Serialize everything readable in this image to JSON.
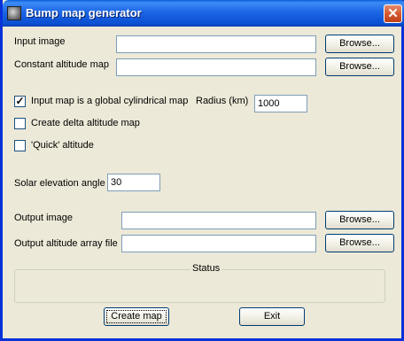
{
  "window": {
    "title": "Bump map generator",
    "close_glyph": "✕"
  },
  "inputs": {
    "input_image": {
      "label": "Input image",
      "value": "",
      "browse_label": "Browse..."
    },
    "constant_altitude_map": {
      "label": "Constant altitude map",
      "value": "",
      "browse_label": "Browse..."
    }
  },
  "options": {
    "global_cylindrical": {
      "label": "Input map is a global cylindrical map",
      "checked": true,
      "check_glyph": "✓"
    },
    "radius": {
      "label": "Radius (km)",
      "value": "1000"
    },
    "delta_altitude": {
      "label": "Create delta altitude map",
      "checked": false
    },
    "quick_altitude": {
      "label": "'Quick' altitude",
      "checked": false
    }
  },
  "solar": {
    "label": "Solar elevation angle",
    "value": "30"
  },
  "outputs": {
    "output_image": {
      "label": "Output image",
      "value": "",
      "browse_label": "Browse..."
    },
    "output_altitude_array": {
      "label": "Output altitude array file",
      "value": "",
      "browse_label": "Browse..."
    }
  },
  "status": {
    "title": "Status",
    "text": ""
  },
  "actions": {
    "create_label": "Create map",
    "exit_label": "Exit"
  }
}
